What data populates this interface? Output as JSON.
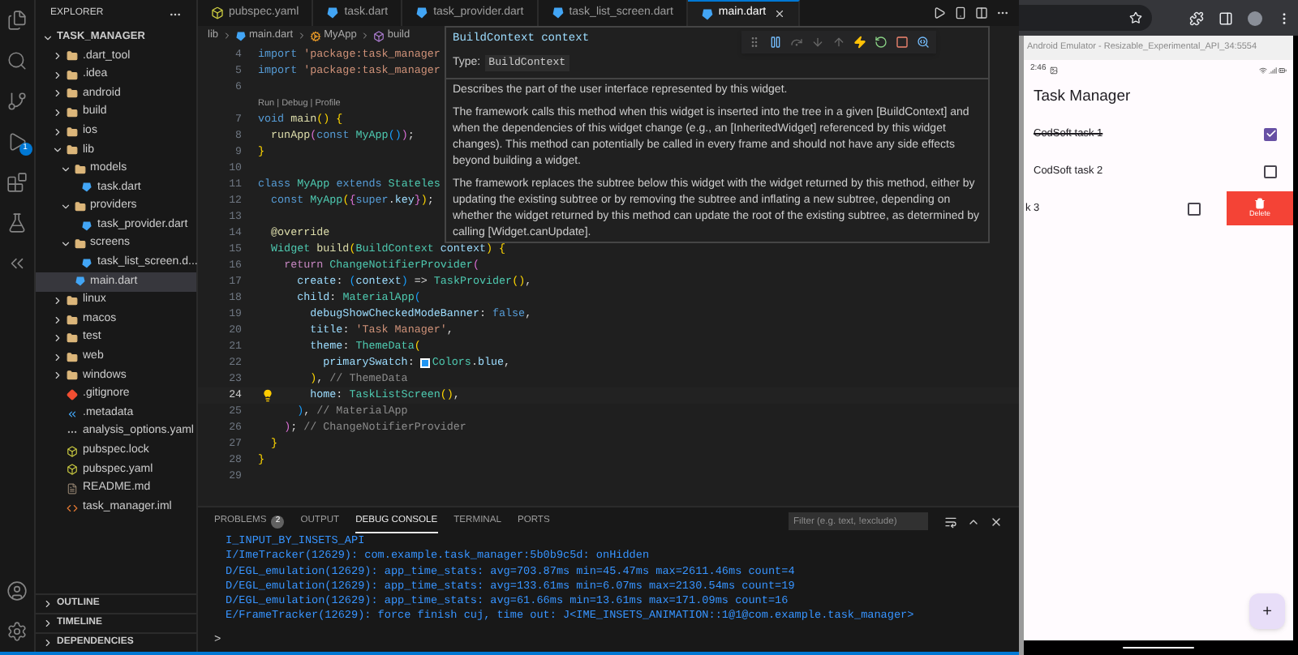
{
  "activity_bar": {
    "debug_badge": "1"
  },
  "explorer": {
    "title": "EXPLORER",
    "root": "TASK_MANAGER",
    "tree": [
      {
        "name": ".dart_tool",
        "kind": "folder",
        "expanded": false,
        "selected": false
      },
      {
        "name": ".idea",
        "kind": "folder",
        "expanded": false,
        "selected": false
      },
      {
        "name": "android",
        "kind": "folder",
        "expanded": false,
        "selected": false
      },
      {
        "name": "build",
        "kind": "folder",
        "expanded": false,
        "selected": false
      },
      {
        "name": "ios",
        "kind": "folder",
        "expanded": false,
        "selected": false
      },
      {
        "name": "lib",
        "kind": "folder",
        "expanded": true,
        "selected": false,
        "children": [
          {
            "name": "models",
            "kind": "folder",
            "expanded": true,
            "selected": false,
            "children": [
              {
                "name": "task.dart",
                "kind": "dart",
                "selected": false
              }
            ]
          },
          {
            "name": "providers",
            "kind": "folder",
            "expanded": true,
            "selected": false,
            "children": [
              {
                "name": "task_provider.dart",
                "kind": "dart",
                "selected": false
              }
            ]
          },
          {
            "name": "screens",
            "kind": "folder",
            "expanded": true,
            "selected": false,
            "children": [
              {
                "name": "task_list_screen.d...",
                "kind": "dart",
                "selected": false
              }
            ]
          },
          {
            "name": "main.dart",
            "kind": "dart",
            "selected": true
          }
        ]
      },
      {
        "name": "linux",
        "kind": "folder",
        "expanded": false,
        "selected": false
      },
      {
        "name": "macos",
        "kind": "folder",
        "expanded": false,
        "selected": false
      },
      {
        "name": "test",
        "kind": "folder",
        "expanded": false,
        "selected": false
      },
      {
        "name": "web",
        "kind": "folder",
        "expanded": false,
        "selected": false
      },
      {
        "name": "windows",
        "kind": "folder",
        "expanded": false,
        "selected": false
      },
      {
        "name": ".gitignore",
        "kind": "git",
        "selected": false
      },
      {
        "name": ".metadata",
        "kind": "metadata",
        "selected": false
      },
      {
        "name": "analysis_options.yaml",
        "kind": "config",
        "selected": false
      },
      {
        "name": "pubspec.lock",
        "kind": "yaml",
        "selected": false
      },
      {
        "name": "pubspec.yaml",
        "kind": "yaml",
        "selected": false
      },
      {
        "name": "README.md",
        "kind": "markdown",
        "selected": false
      },
      {
        "name": "task_manager.iml",
        "kind": "xml",
        "selected": false
      }
    ],
    "sections": [
      "OUTLINE",
      "TIMELINE",
      "DEPENDENCIES"
    ]
  },
  "editor": {
    "tabs": [
      {
        "label": "pubspec.yaml",
        "kind": "yaml",
        "selected": false
      },
      {
        "label": "task.dart",
        "kind": "dart",
        "selected": false
      },
      {
        "label": "task_provider.dart",
        "kind": "dart",
        "selected": false
      },
      {
        "label": "task_list_screen.dart",
        "kind": "dart",
        "selected": false
      },
      {
        "label": "main.dart",
        "kind": "dart",
        "selected": true
      }
    ],
    "breadcrumb": [
      {
        "label": "lib",
        "kind": "folder"
      },
      {
        "label": "main.dart",
        "kind": "dart"
      },
      {
        "label": "MyApp",
        "kind": "class"
      },
      {
        "label": "build",
        "kind": "method"
      }
    ],
    "lines": [
      {
        "kind": "code",
        "number": "4",
        "current": false,
        "tokens": [
          {
            "text": "import",
            "kind": "keyword"
          },
          {
            "text": " 'package:task_manager",
            "kind": "string"
          }
        ]
      },
      {
        "kind": "code",
        "number": "5",
        "current": false,
        "tokens": [
          {
            "text": "import",
            "kind": "keyword"
          },
          {
            "text": " 'package:task_manager",
            "kind": "string"
          }
        ]
      },
      {
        "kind": "code",
        "number": "6",
        "current": false
      },
      {
        "kind": "codelens",
        "text": "Run | Debug | Profile"
      },
      {
        "kind": "code",
        "number": "7",
        "current": false,
        "tokens": [
          {
            "text": "void ",
            "kind": "keyword"
          },
          {
            "text": "main",
            "kind": "function"
          },
          {
            "text": "() {",
            "kind": "bracket1"
          }
        ]
      },
      {
        "kind": "code",
        "number": "8",
        "current": false,
        "tokens": [
          {
            "text": "  runApp",
            "kind": "function"
          },
          {
            "text": "(",
            "kind": "bracket2"
          },
          {
            "text": "const ",
            "kind": "keyword"
          },
          {
            "text": "MyApp",
            "kind": "type"
          },
          {
            "text": "()",
            "kind": "bracket3"
          },
          {
            "text": ")",
            "kind": "bracket2"
          },
          {
            "text": ";",
            "kind": "plain"
          }
        ]
      },
      {
        "kind": "code",
        "number": "9",
        "current": false,
        "tokens": [
          {
            "text": "}",
            "kind": "bracket1"
          }
        ]
      },
      {
        "kind": "code",
        "number": "10",
        "current": false
      },
      {
        "kind": "code",
        "number": "11",
        "current": false,
        "tokens": [
          {
            "text": "class ",
            "kind": "keyword"
          },
          {
            "text": "MyApp ",
            "kind": "type"
          },
          {
            "text": "extends ",
            "kind": "keyword"
          },
          {
            "text": "Stateles",
            "kind": "type"
          }
        ]
      },
      {
        "kind": "code",
        "number": "12",
        "current": false,
        "tokens": [
          {
            "text": "  const ",
            "kind": "keyword"
          },
          {
            "text": "MyApp",
            "kind": "type"
          },
          {
            "text": "(",
            "kind": "bracket1"
          },
          {
            "text": "{",
            "kind": "bracket2"
          },
          {
            "text": "super",
            "kind": "keyword"
          },
          {
            "text": ".",
            "kind": "plain"
          },
          {
            "text": "key",
            "kind": "variable"
          },
          {
            "text": "}",
            "kind": "bracket2"
          },
          {
            "text": ")",
            "kind": "bracket1"
          },
          {
            "text": ";",
            "kind": "plain"
          }
        ]
      },
      {
        "kind": "code",
        "number": "13",
        "current": false
      },
      {
        "kind": "code",
        "number": "14",
        "current": false,
        "tokens": [
          {
            "text": "  @override",
            "kind": "annotation"
          }
        ]
      },
      {
        "kind": "code",
        "number": "15",
        "current": false,
        "tokens": [
          {
            "text": "  Widget ",
            "kind": "type"
          },
          {
            "text": "build",
            "kind": "function"
          },
          {
            "text": "(",
            "kind": "bracket1"
          },
          {
            "text": "BuildContext ",
            "kind": "type"
          },
          {
            "text": "context",
            "kind": "variable"
          },
          {
            "text": ") {",
            "kind": "bracket1"
          }
        ]
      },
      {
        "kind": "code",
        "number": "16",
        "current": false,
        "tokens": [
          {
            "text": "    return ",
            "kind": "control"
          },
          {
            "text": "ChangeNotifierProvider",
            "kind": "type"
          },
          {
            "text": "(",
            "kind": "bracket2"
          }
        ]
      },
      {
        "kind": "code",
        "number": "17",
        "current": false,
        "tokens": [
          {
            "text": "      create",
            "kind": "variable"
          },
          {
            "text": ": ",
            "kind": "plain"
          },
          {
            "text": "(",
            "kind": "bracket3"
          },
          {
            "text": "context",
            "kind": "variable"
          },
          {
            "text": ")",
            "kind": "bracket3"
          },
          {
            "text": " => ",
            "kind": "plain"
          },
          {
            "text": "TaskProvider",
            "kind": "type"
          },
          {
            "text": "()",
            "kind": "bracket1"
          },
          {
            "text": ",",
            "kind": "plain"
          }
        ]
      },
      {
        "kind": "code",
        "number": "18",
        "current": false,
        "tokens": [
          {
            "text": "      child",
            "kind": "variable"
          },
          {
            "text": ": ",
            "kind": "plain"
          },
          {
            "text": "MaterialApp",
            "kind": "type"
          },
          {
            "text": "(",
            "kind": "bracket3"
          }
        ]
      },
      {
        "kind": "code",
        "number": "19",
        "current": false,
        "tokens": [
          {
            "text": "        debugShowCheckedModeBanner",
            "kind": "variable"
          },
          {
            "text": ": ",
            "kind": "plain"
          },
          {
            "text": "false",
            "kind": "keyword"
          },
          {
            "text": ",",
            "kind": "plain"
          }
        ]
      },
      {
        "kind": "code",
        "number": "20",
        "current": false,
        "tokens": [
          {
            "text": "        title",
            "kind": "variable"
          },
          {
            "text": ": ",
            "kind": "plain"
          },
          {
            "text": "'Task Manager'",
            "kind": "string"
          },
          {
            "text": ",",
            "kind": "plain"
          }
        ]
      },
      {
        "kind": "code",
        "number": "21",
        "current": false,
        "tokens": [
          {
            "text": "        theme",
            "kind": "variable"
          },
          {
            "text": ": ",
            "kind": "plain"
          },
          {
            "text": "ThemeData",
            "kind": "type"
          },
          {
            "text": "(",
            "kind": "bracket1"
          }
        ]
      },
      {
        "kind": "code",
        "number": "22",
        "current": false,
        "tokens": [
          {
            "text": "          primarySwatch",
            "kind": "variable"
          },
          {
            "text": ": ",
            "kind": "plain"
          },
          {
            "kind": "swatch"
          },
          {
            "text": "Colors",
            "kind": "type"
          },
          {
            "text": ".",
            "kind": "plain"
          },
          {
            "text": "blue",
            "kind": "variable"
          },
          {
            "text": ",",
            "kind": "plain"
          }
        ]
      },
      {
        "kind": "code",
        "number": "23",
        "current": false,
        "tokens": [
          {
            "text": "        )",
            "kind": "bracket1"
          },
          {
            "text": ", ",
            "kind": "plain"
          },
          {
            "text": "// ThemeData",
            "kind": "comment"
          }
        ]
      },
      {
        "kind": "code",
        "number": "24",
        "current": true,
        "tokens": [
          {
            "text": "        home",
            "kind": "variable"
          },
          {
            "text": ": ",
            "kind": "plain"
          },
          {
            "text": "TaskListScreen",
            "kind": "type"
          },
          {
            "text": "()",
            "kind": "bracket1"
          },
          {
            "text": ",",
            "kind": "plain"
          }
        ]
      },
      {
        "kind": "code",
        "number": "25",
        "current": false,
        "tokens": [
          {
            "text": "      )",
            "kind": "bracket3"
          },
          {
            "text": ", ",
            "kind": "plain"
          },
          {
            "text": "// MaterialApp",
            "kind": "comment"
          }
        ]
      },
      {
        "kind": "code",
        "number": "26",
        "current": false,
        "tokens": [
          {
            "text": "    )",
            "kind": "bracket2"
          },
          {
            "text": "; ",
            "kind": "plain"
          },
          {
            "text": "// ChangeNotifierProvider",
            "kind": "comment"
          }
        ]
      },
      {
        "kind": "code",
        "number": "27",
        "current": false,
        "tokens": [
          {
            "text": "  }",
            "kind": "bracket1"
          }
        ]
      },
      {
        "kind": "code",
        "number": "28",
        "current": false,
        "tokens": [
          {
            "text": "}",
            "kind": "bracket1"
          }
        ]
      },
      {
        "kind": "code",
        "number": "29",
        "current": false
      }
    ],
    "hover": {
      "signature": "BuildContext context",
      "type_label": "Type:",
      "type": "BuildContext",
      "paragraphs": [
        "Describes the part of the user interface represented by this widget.",
        "The framework calls this method when this widget is inserted into the tree in a given [BuildContext] and when the dependencies of this widget change (e.g., an [InheritedWidget] referenced by this widget changes). This method can potentially be called in every frame and should not have any side effects beyond building a widget.",
        "The framework replaces the subtree below this widget with the widget returned by this method, either by updating the existing subtree or by removing the subtree and inflating a new subtree, depending on whether the widget returned by this method can update the root of the existing subtree, as determined by calling [Widget.canUpdate]."
      ]
    }
  },
  "panel": {
    "tabs": [
      {
        "label": "PROBLEMS",
        "badge": "2",
        "selected": false
      },
      {
        "label": "OUTPUT",
        "selected": false
      },
      {
        "label": "DEBUG CONSOLE",
        "selected": true
      },
      {
        "label": "TERMINAL",
        "selected": false
      },
      {
        "label": "PORTS",
        "selected": false
      }
    ],
    "filter_placeholder": "Filter (e.g. text, !exclude)",
    "console": [
      "I_INPUT_BY_INSETS_API",
      "I/ImeTracker(12629): com.example.task_manager:5b0b9c5d: onHidden",
      "D/EGL_emulation(12629): app_time_stats: avg=703.87ms min=45.47ms max=2611.46ms count=4",
      "D/EGL_emulation(12629): app_time_stats: avg=133.61ms min=6.07ms max=2130.54ms count=19",
      "D/EGL_emulation(12629): app_time_stats: avg=61.66ms min=13.61ms max=171.09ms count=16",
      "E/FrameTracker(12629): force finish cuj, time out: J<IME_INSETS_ANIMATION::1@1@com.example.task_manager>"
    ],
    "prompt": ">"
  },
  "emulator": {
    "title": "Android Emulator - Resizable_Experimental_API_34:5554",
    "time": "2:46",
    "app_title": "Task Manager",
    "tasks": [
      {
        "title": "CodSoft task 1",
        "done": true,
        "swiped": false
      },
      {
        "title": "CodSoft task 2",
        "done": false,
        "swiped": false
      },
      {
        "title": "k 3",
        "done": false,
        "swiped": true
      }
    ],
    "delete_label": "Delete",
    "fab": "+"
  }
}
